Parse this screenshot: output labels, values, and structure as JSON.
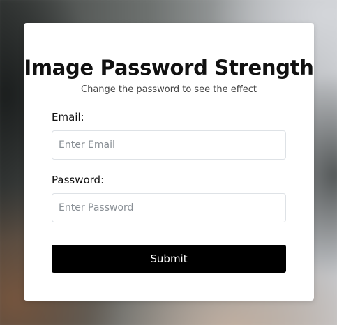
{
  "form": {
    "title": "Image Password Strength",
    "subtitle": "Change the password to see the effect",
    "email_label": "Email:",
    "email_placeholder": "Enter Email",
    "email_value": "",
    "password_label": "Password:",
    "password_placeholder": "Enter Password",
    "password_value": "",
    "submit_label": "Submit"
  },
  "colors": {
    "button_background": "#000000",
    "button_text": "#ffffff",
    "card_background": "#ffffff"
  }
}
